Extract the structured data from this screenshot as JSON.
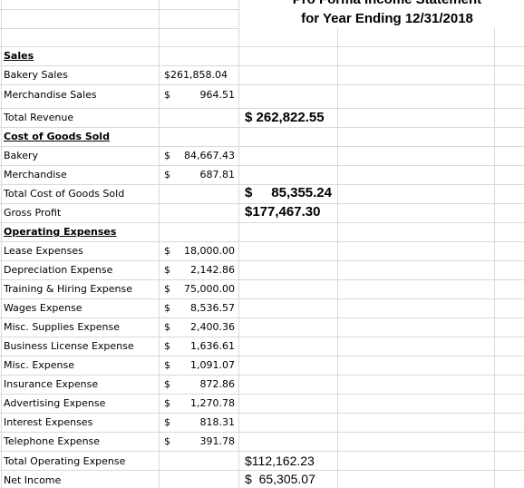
{
  "title": {
    "line1": "Pro Forma Income Statement",
    "line2": "for Year Ending 12/31/2018"
  },
  "currency_symbol": "$",
  "rows": {
    "sales_header": "Sales",
    "bakery_sales": {
      "label": "Bakery Sales",
      "amount": "261,858.04"
    },
    "merchandise_sales": {
      "label": "Merchandise Sales",
      "amount": "964.51"
    },
    "total_revenue": {
      "label": "Total Revenue",
      "total": "262,822.55"
    },
    "cogs_header": "Cost of Goods Sold",
    "bakery": {
      "label": "Bakery",
      "amount": "84,667.43"
    },
    "merchandise": {
      "label": "Merchandise",
      "amount": "687.81"
    },
    "total_cogs": {
      "label": "Total Cost of Goods Sold",
      "total": "85,355.24"
    },
    "gross_profit": {
      "label": "Gross Profit",
      "total": "177,467.30"
    },
    "opex_header": "Operating Expenses",
    "lease": {
      "label": "Lease Expenses",
      "amount": "18,000.00"
    },
    "depreciation": {
      "label": "Depreciation Expense",
      "amount": "2,142.86"
    },
    "training": {
      "label": "Training & Hiring Expense",
      "amount": "75,000.00"
    },
    "wages": {
      "label": "Wages Expense",
      "amount": "8,536.57"
    },
    "misc_supplies": {
      "label": "Misc. Supplies Expense",
      "amount": "2,400.36"
    },
    "business_license": {
      "label": "Business License Expense",
      "amount": "1,636.61"
    },
    "misc": {
      "label": "Misc. Expense",
      "amount": "1,091.07"
    },
    "insurance": {
      "label": "Insurance Expense",
      "amount": "872.86"
    },
    "advertising": {
      "label": "Advertising Expense",
      "amount": "1,270.78"
    },
    "interest": {
      "label": "Interest Expenses",
      "amount": "818.31"
    },
    "telephone": {
      "label": "Telephone Expense",
      "amount": "391.78"
    },
    "total_opex": {
      "label": "Total Operating Expense",
      "total": "112,162.23"
    },
    "net_income": {
      "label": "Net Income",
      "total": "65,305.07"
    }
  }
}
